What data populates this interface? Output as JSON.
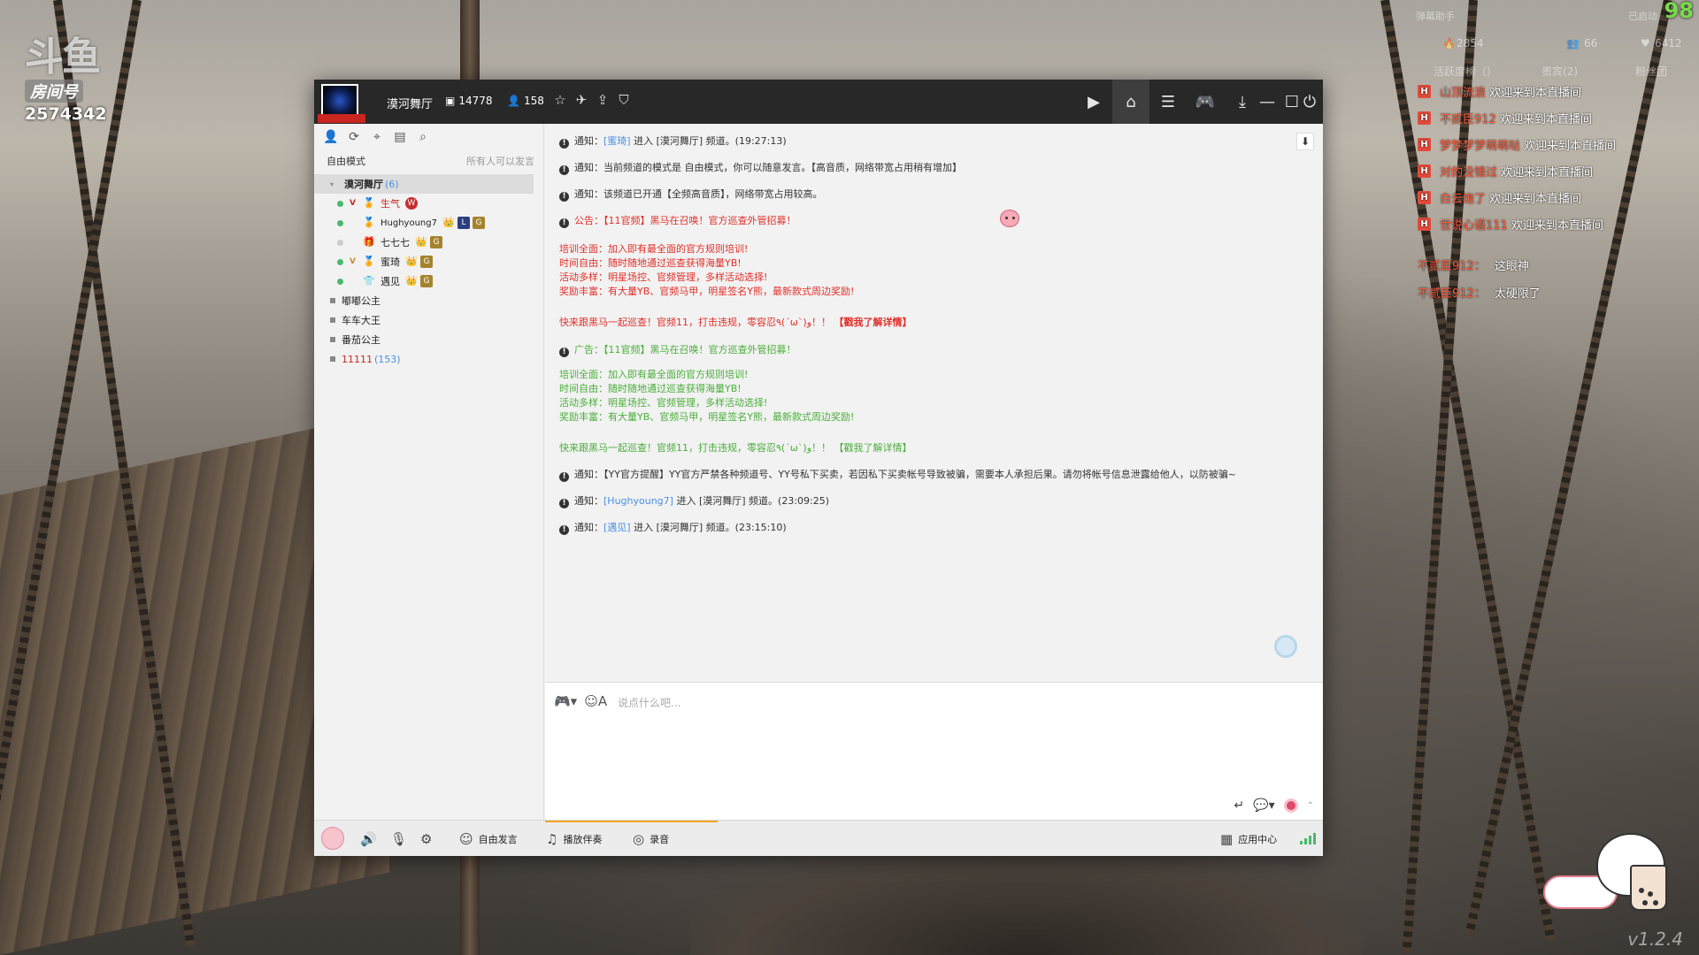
{
  "overlay": {
    "logo_mark": "斗鱼",
    "room_label": "房间号",
    "room_number": "2574342",
    "right_top_left": "弹幕助手",
    "right_top_right": "已启动",
    "right_big_number": "98",
    "stats": [
      "2854",
      "66",
      "6412"
    ],
    "tabs": [
      "活跃度榜（）",
      "贵宾(2)",
      "粉丝团"
    ],
    "welcome": [
      {
        "badge": "H",
        "user": "山顶流浪",
        "text": "欢迎来到本直播间"
      },
      {
        "badge": "H",
        "user": "不贰臣912",
        "text": "欢迎来到本直播间"
      },
      {
        "badge": "H",
        "user": "梦梦梦梦萌萌哒",
        "text": "欢迎来到本直播间"
      },
      {
        "badge": "H",
        "user": "对的没错过",
        "text": "欢迎来到本直播间"
      },
      {
        "badge": "H",
        "user": "白云饱了",
        "text": "欢迎来到本直播间"
      },
      {
        "badge": "H",
        "user": "世说心语111",
        "text": "欢迎来到本直播间"
      }
    ],
    "chat": [
      {
        "user": "不贰臣912：",
        "text": "这眼神"
      },
      {
        "user": "不贰臣912：",
        "text": "太硬限了"
      }
    ],
    "version": "v1.2.4"
  },
  "window": {
    "channel_name": "漠河舞厅",
    "channel_id": "14778",
    "online_count": "158",
    "title_icons": [
      "star-icon",
      "plane-icon",
      "share-icon",
      "shield-icon"
    ],
    "right_icons": [
      "video-icon",
      "home-icon",
      "list-icon",
      "gamepad-icon",
      "download-icon",
      "minimize-icon",
      "maximize-icon",
      "power-icon"
    ]
  },
  "sidebar": {
    "mode": "自由模式",
    "mode_note": "所有人可以发言",
    "channels": [
      {
        "name": "漠河舞厅",
        "count": "(6)",
        "selected": true
      },
      {
        "name": "嘟嘟公主",
        "count": ""
      },
      {
        "name": "车车大王",
        "count": ""
      },
      {
        "name": "番茄公主",
        "count": ""
      },
      {
        "name": "11111",
        "count": "(153)"
      }
    ],
    "members": [
      {
        "vtag": "V",
        "name": "生气",
        "badges": [
          "W"
        ],
        "status": "on",
        "red": true
      },
      {
        "vtag": "",
        "name": "Hughyoung7",
        "badges": [
          "C",
          "L",
          "G"
        ],
        "status": "on",
        "red": false
      },
      {
        "vtag": "",
        "name": "七七七",
        "badges": [
          "C",
          "G"
        ],
        "status": "off",
        "red": false
      },
      {
        "vtag": "V",
        "name": "蜜琦",
        "badges": [
          "C",
          "G"
        ],
        "status": "on",
        "red": false
      },
      {
        "vtag": "",
        "name": "遇见",
        "badges": [
          "C",
          "G"
        ],
        "status": "on",
        "red": false
      }
    ]
  },
  "messages": {
    "m1": {
      "label": "通知：",
      "user": "[蜜琦]",
      "text": "进入 [漠河舞厅] 频道。(19:27:13)"
    },
    "m2": {
      "label": "通知：",
      "text": "当前频道的模式是 自由模式，你可以随意发言。【高音质，网络带宽占用稍有增加】"
    },
    "m3": {
      "label": "通知：",
      "text": "该频道已开通【全频高音质】，网络带宽占用较高。"
    },
    "m4": {
      "label": "公告：",
      "text": "【11官频】黑马在召唤！官方巡查外管招募！"
    },
    "block1": [
      "培训全面：加入即有最全面的官方规则培训!",
      "时间自由：随时随地通过巡查获得海量YB!",
      "活动多样：明星场控、官频管理，多样活动选择!",
      "奖励丰富：有大量YB、官频马甲，明星签名Y熊，最新款式周边奖励!"
    ],
    "m5": {
      "text": "快来跟黑马一起巡查！官频11，打击违规，零容忍٩(ˊωˋ)و！！",
      "link": "【戳我了解详情】"
    },
    "m6": {
      "label": "广告：",
      "text": "【11官频】黑马在召唤！官方巡查外管招募！"
    },
    "block2": [
      "培训全面：加入即有最全面的官方规则培训!",
      "时间自由：随时随地通过巡查获得海量YB!",
      "活动多样：明星场控、官频管理，多样活动选择!",
      "奖励丰富：有大量YB、官频马甲，明星签名Y熊，最新款式周边奖励!"
    ],
    "m7": {
      "text": "快来跟黑马一起巡查！官频11，打击违规，零容忍٩(ˊωˋ)و！！",
      "link": "【戳我了解详情】"
    },
    "m8": {
      "label": "通知：",
      "text": "【YY官方提醒】YY官方严禁各种频道号、YY号私下买卖，若因私下买卖帐号导致被骗，需要本人承担后果。请勿将帐号信息泄露给他人，以防被骗~"
    },
    "m9": {
      "label": "通知：",
      "user": "[Hughyoung7]",
      "text": "进入 [漠河舞厅] 频道。(23:09:25)"
    },
    "m10": {
      "label": "通知：",
      "user": "[遇见]",
      "text": "进入 [漠河舞厅] 频道。(23:15:10)"
    }
  },
  "input": {
    "placeholder": "说点什么吧..."
  },
  "bottom_bar": {
    "free_speak": "自由发言",
    "play_music": "播放伴奏",
    "record": "录音",
    "app_center": "应用中心"
  },
  "colors": {
    "accent_orange": "#f5a623",
    "title_bg": "#282828",
    "notice_red": "#e0302a",
    "notice_green": "#4aae3a",
    "link_blue": "#4a90e2"
  }
}
